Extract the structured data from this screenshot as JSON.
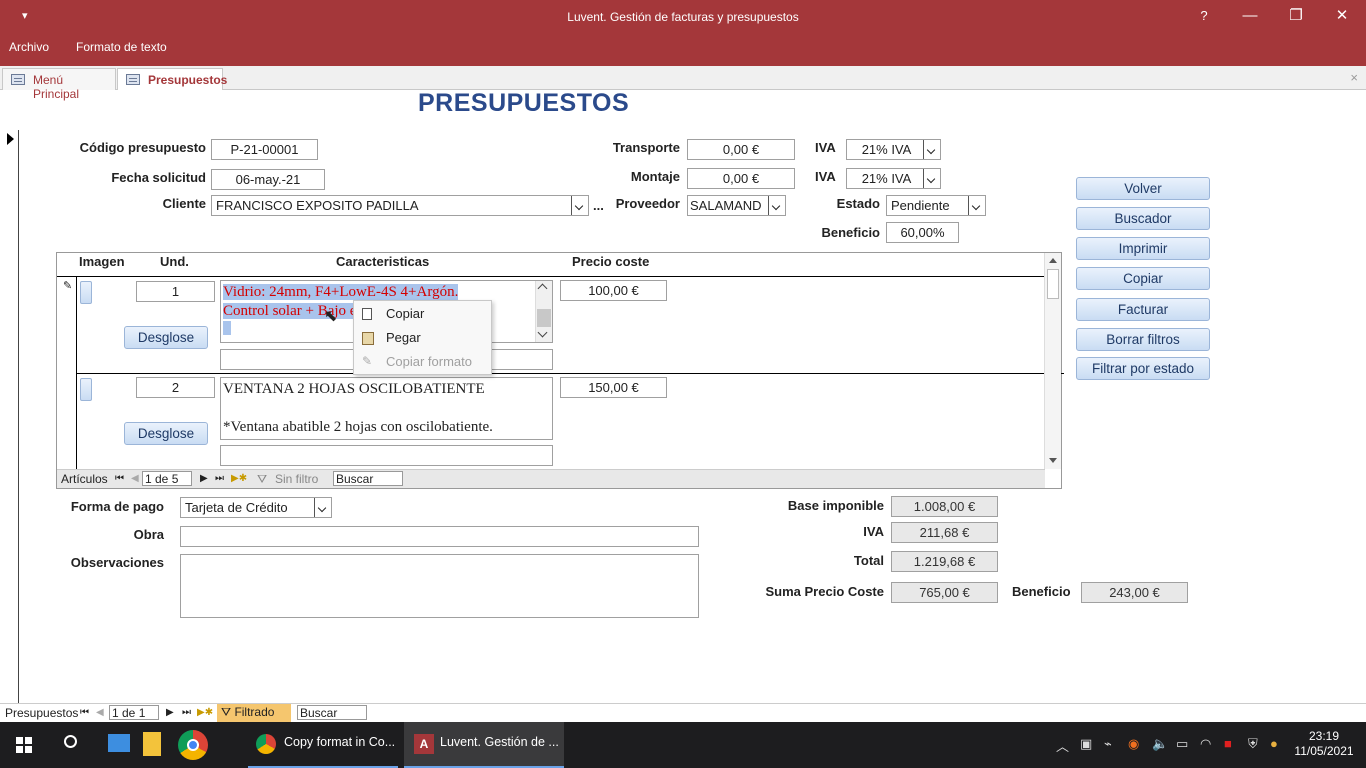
{
  "window": {
    "title": "Luvent. Gestión de facturas y presupuestos",
    "help_label": "?",
    "minimize_label": "—",
    "restore_label": "❐",
    "close_label": "✕",
    "qat_label": "▾"
  },
  "ribbon": {
    "tabs": [
      {
        "label": "Archivo"
      },
      {
        "label": "Formato de texto"
      }
    ]
  },
  "doc_tabs": [
    {
      "label": "Menú Principal"
    },
    {
      "label": "Presupuestos"
    }
  ],
  "doc_close_label": "×",
  "form": {
    "title": "PRESUPUESTOS",
    "codigo_label": "Código presupuesto",
    "codigo_value": "P-21-00001",
    "fecha_label": "Fecha solicitud",
    "fecha_value": "06-may.-21",
    "cliente_label": "Cliente",
    "cliente_value": "FRANCISCO EXPOSITO PADILLA",
    "cliente_more": "...",
    "transporte_label": "Transporte",
    "transporte_value": "0,00 €",
    "montaje_label": "Montaje",
    "montaje_value": "0,00 €",
    "iva_label": "IVA",
    "iva1_value": "21% IVA",
    "iva2_value": "21% IVA",
    "proveedor_label": "Proveedor",
    "proveedor_value": "SALAMAND",
    "estado_label": "Estado",
    "estado_value": "Pendiente",
    "beneficio_label": "Beneficio",
    "beneficio_value": "60,00%"
  },
  "buttons": {
    "volver": "Volver",
    "buscador": "Buscador",
    "imprimir": "Imprimir",
    "copiar": "Copiar",
    "facturar": "Facturar",
    "borrar_filtros": "Borrar filtros",
    "filtrar_estado": "Filtrar por estado"
  },
  "subform": {
    "columns": {
      "imagen": "Imagen",
      "und": "Und.",
      "caracteristicas": "Caracteristicas",
      "precio": "Precio coste"
    },
    "rows": [
      {
        "und": "1",
        "line1": "Vidrio: 24mm, F4+LowE-4S 4+Argón.",
        "line2_a": "Control solar + B",
        "line2_b": "ajo e",
        "precio": "100,00 €",
        "desglose": "Desglose",
        "pencil": "✎"
      },
      {
        "und": "2",
        "line1": "VENTANA 2 HOJAS OSCILOBATIENTE",
        "line2": "*Ventana abatible 2 hojas con oscilobatiente.",
        "precio": "150,00 €",
        "desglose": "Desglose"
      }
    ],
    "nav": {
      "label": "Artículos",
      "record": "1 de 5",
      "filter": "Sin filtro",
      "search": "Buscar"
    }
  },
  "context_menu": {
    "items": [
      {
        "label": "Copiar",
        "enabled": true
      },
      {
        "label": "Pegar",
        "enabled": true
      },
      {
        "label": "Copiar formato",
        "enabled": false
      }
    ]
  },
  "footer": {
    "forma_pago_label": "Forma de pago",
    "forma_pago_value": "Tarjeta de Crédito",
    "obra_label": "Obra",
    "obra_value": "",
    "observaciones_label": "Observaciones",
    "observaciones_value": "",
    "base_label": "Base imponible",
    "base_value": "1.008,00 €",
    "iva_label": "IVA",
    "iva_value": "211,68 €",
    "total_label": "Total",
    "total_value": "1.219,68 €",
    "suma_label": "Suma Precio Coste",
    "suma_value": "765,00 €",
    "beneficio_label": "Beneficio",
    "beneficio_value": "243,00 €"
  },
  "main_nav": {
    "label": "Presupuestos",
    "record": "1 de 1",
    "filter": "Filtrado",
    "search": "Buscar"
  },
  "taskbar": {
    "apps": [
      {
        "label": "Copy format in Co..."
      },
      {
        "label": "Luvent. Gestión de ..."
      }
    ],
    "time": "23:19",
    "date": "11/05/2021"
  },
  "colors": {
    "title_bar": "#a4373a",
    "form_title": "#2b4a8b",
    "selected_text": "#d40000",
    "selection_bg": "#a9c4ec"
  }
}
